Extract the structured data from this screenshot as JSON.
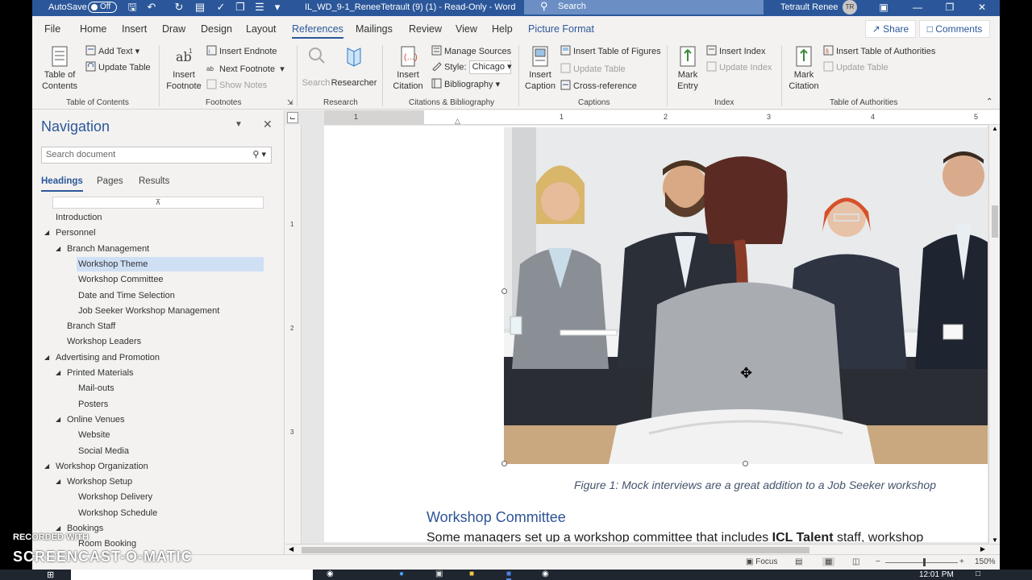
{
  "titlebar": {
    "autosave_label": "AutoSave",
    "autosave_state": "Off",
    "doc_title": "IL_WD_9-1_ReneeTetrault (9) (1)  -  Read-Only  -  Word",
    "search_placeholder": "Search",
    "user_name": "Tetrault Renee",
    "user_initials": "TR",
    "accent_color": "#2b579a"
  },
  "tabs": [
    "File",
    "Home",
    "Insert",
    "Draw",
    "Design",
    "Layout",
    "References",
    "Mailings",
    "Review",
    "View",
    "Help",
    "Picture Format"
  ],
  "active_tab": "References",
  "share_label": "Share",
  "comments_label": "Comments",
  "ribbon": {
    "toc": {
      "big": "Table of Contents",
      "add_text": "Add Text",
      "update_table": "Update Table",
      "group": "Table of Contents"
    },
    "footnotes": {
      "big": "Insert Footnote",
      "insert_endnote": "Insert Endnote",
      "next_footnote": "Next Footnote",
      "show_notes": "Show Notes",
      "group": "Footnotes"
    },
    "research": {
      "search": "Search",
      "researcher": "Researcher",
      "group": "Research"
    },
    "citations": {
      "big": "Insert Citation",
      "manage_sources": "Manage Sources",
      "style_label": "Style:",
      "style_value": "Chicago",
      "bibliography": "Bibliography",
      "group": "Citations & Bibliography"
    },
    "captions": {
      "big": "Insert Caption",
      "insert_tof": "Insert Table of Figures",
      "update_table": "Update Table",
      "cross_ref": "Cross-reference",
      "group": "Captions"
    },
    "index": {
      "big": "Mark Entry",
      "insert_index": "Insert Index",
      "update_index": "Update Index",
      "group": "Index"
    },
    "toa": {
      "big": "Mark Citation",
      "insert_toa": "Insert Table of Authorities",
      "update_table": "Update Table",
      "group": "Table of Authorities"
    }
  },
  "nav": {
    "title": "Navigation",
    "search_placeholder": "Search document",
    "tabs": [
      "Headings",
      "Pages",
      "Results"
    ],
    "items": [
      {
        "label": "Introduction",
        "level": 1,
        "expanded": null,
        "selected": false
      },
      {
        "label": "Personnel",
        "level": 1,
        "expanded": true,
        "selected": false
      },
      {
        "label": "Branch Management",
        "level": 2,
        "expanded": true,
        "selected": false
      },
      {
        "label": "Workshop Theme",
        "level": 3,
        "expanded": null,
        "selected": true
      },
      {
        "label": "Workshop Committee",
        "level": 3,
        "expanded": null,
        "selected": false
      },
      {
        "label": "Date and Time Selection",
        "level": 3,
        "expanded": null,
        "selected": false
      },
      {
        "label": "Job Seeker Workshop Management",
        "level": 3,
        "expanded": null,
        "selected": false
      },
      {
        "label": "Branch Staff",
        "level": 2,
        "expanded": null,
        "selected": false
      },
      {
        "label": "Workshop Leaders",
        "level": 2,
        "expanded": null,
        "selected": false
      },
      {
        "label": "Advertising and Promotion",
        "level": 1,
        "expanded": true,
        "selected": false
      },
      {
        "label": "Printed Materials",
        "level": 2,
        "expanded": true,
        "selected": false
      },
      {
        "label": "Mail-outs",
        "level": 3,
        "expanded": null,
        "selected": false
      },
      {
        "label": "Posters",
        "level": 3,
        "expanded": null,
        "selected": false
      },
      {
        "label": "Online Venues",
        "level": 2,
        "expanded": true,
        "selected": false
      },
      {
        "label": "Website",
        "level": 3,
        "expanded": null,
        "selected": false
      },
      {
        "label": "Social Media",
        "level": 3,
        "expanded": null,
        "selected": false
      },
      {
        "label": "Workshop Organization",
        "level": 1,
        "expanded": true,
        "selected": false
      },
      {
        "label": "Workshop Setup",
        "level": 2,
        "expanded": true,
        "selected": false
      },
      {
        "label": "Workshop Delivery",
        "level": 3,
        "expanded": null,
        "selected": false
      },
      {
        "label": "Workshop Schedule",
        "level": 3,
        "expanded": null,
        "selected": false
      },
      {
        "label": "Bookings",
        "level": 2,
        "expanded": true,
        "selected": false
      },
      {
        "label": "Room Booking",
        "level": 3,
        "expanded": null,
        "selected": false
      }
    ]
  },
  "ruler": {
    "h_numbers": [
      "1",
      "1",
      "2",
      "3",
      "4",
      "5"
    ],
    "v_numbers": [
      "1",
      "2",
      "3"
    ]
  },
  "document": {
    "caption": "Figure 1: Mock interviews are a great addition to a Job Seeker workshop",
    "heading": "Workshop Committee",
    "body_start": "Some managers set up a workshop committee that includes ",
    "body_bold": "ICL Talent",
    "body_end": " staff, workshop"
  },
  "statusbar": {
    "focus_label": "Focus",
    "zoom": "150%"
  },
  "taskbar": {
    "clock": "12:01 PM"
  },
  "watermark": {
    "line1": "RECORDED WITH",
    "line2": "SCREENCAST-O-MATIC"
  }
}
